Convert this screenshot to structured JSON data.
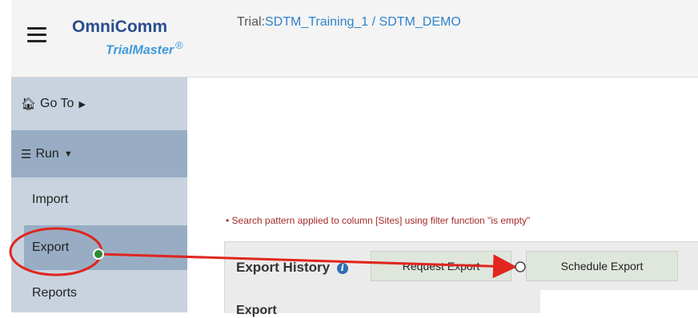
{
  "header": {
    "brand_name": "OmniComm",
    "brand_product": "TrialMaster",
    "brand_mark": "®",
    "trial_prefix": "Trial:",
    "trial_path": "SDTM_Training_1 / SDTM_DEMO"
  },
  "sidebar": {
    "goto_label": "Go To",
    "run_label": "Run",
    "items": [
      {
        "label": "Import"
      },
      {
        "label": "Export"
      },
      {
        "label": "Reports"
      }
    ]
  },
  "main": {
    "notice": "Search pattern applied to column [Sites] using filter function \"is empty\"",
    "panel_title": "Export History",
    "request_label": "Request Export",
    "schedule_label": "Schedule Export",
    "sub_label": "Export"
  },
  "icons": {
    "menu": "hamburger-icon",
    "home": "home-icon",
    "run": "server-icon",
    "info": "info-icon",
    "caret_right": "caret-right-icon",
    "caret_down": "caret-down-icon"
  },
  "colors": {
    "sidebar_bg": "#c8d3df",
    "sidebar_active": "#98adc4",
    "brand": "#2a4d8f",
    "annotation": "#e0261f",
    "notice": "#a32a2a"
  }
}
